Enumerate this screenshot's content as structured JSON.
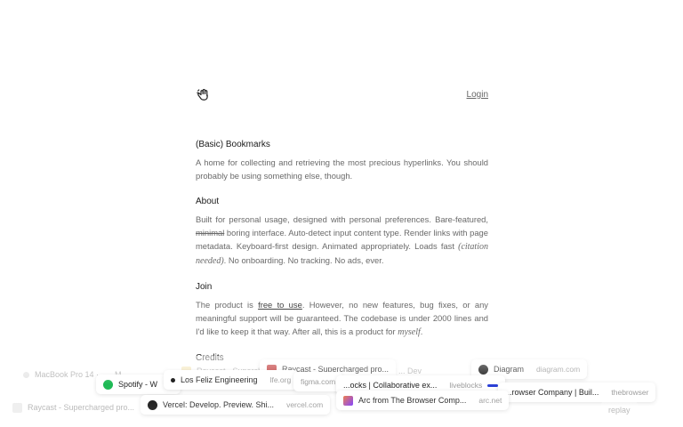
{
  "header": {
    "login_label": "Login"
  },
  "intro": {
    "title": "(Basic) Bookmarks",
    "text": "A home for collecting and retrieving the most precious hyperlinks. You should probably be using something else, though."
  },
  "about": {
    "title": "About",
    "text_a": "Built for personal usage, designed with personal preferences. Bare-featured, ",
    "strike": "minimal",
    "text_b": " boring interface. Auto-detect input content type. Render links with page metadata. Keyboard-first design. Animated appropriately. Loads fast ",
    "citation": "(citation needed)",
    "text_c": ". No onboarding. No tracking. No ads, ever."
  },
  "join": {
    "title": "Join",
    "text_a": "The product is ",
    "link": "free to use",
    "text_b": ". However, no new features, bug fixes, or any meaningful support will be guaranteed. The codebase is under 2000 lines and I'd like to keep it that way. After all, this is a product for ",
    "myself": "myself",
    "text_c": "."
  },
  "credits": {
    "title": "Credits"
  },
  "cards": [
    {
      "title": "MacBook Pro 14 · ... · M",
      "domain": "",
      "icon": "apple-icon",
      "color": "#999999",
      "faded": true
    },
    {
      "title": "Raycast - Supercharged pro...",
      "domain": "",
      "icon": "raycast-icon",
      "color": "#d14242",
      "faded": true
    },
    {
      "title": "Raycast - Supercharged pro...",
      "domain": "",
      "icon": "raycast-icon",
      "color": "#333333",
      "faded": false
    },
    {
      "title": "Spotify - W",
      "domain": "",
      "icon": "spotify-icon",
      "color": "#1db954",
      "faded": false
    },
    {
      "title": "Los Feliz Engineering",
      "domain": "lfe.org",
      "icon": "dot-icon",
      "color": "#111111",
      "faded": false
    },
    {
      "title": "figma.com",
      "domain": "",
      "icon": "figma-icon",
      "color": "#ffffff",
      "faded": false
    },
    {
      "title": "Vercel: Develop. Preview. Shi...",
      "domain": "vercel.com",
      "icon": "vercel-icon",
      "color": "#111111",
      "faded": false
    },
    {
      "title": "...ocks | Collaborative ex...",
      "domain": "liveblocks",
      "icon": "liveblocks-icon",
      "color": "#ffffff",
      "faded": false
    },
    {
      "title": "Arc from The Browser Comp...",
      "domain": "arc.net",
      "icon": "arc-icon",
      "color": "#7b3fe4",
      "faded": false
    },
    {
      "title": "Diagram",
      "domain": "diagram.com",
      "icon": "diagram-icon",
      "color": "#111111",
      "faded": false
    },
    {
      "title": "...rowser Company | Buil...",
      "domain": "thebrowser",
      "icon": "browser-icon",
      "color": "#3344cc",
      "faded": false
    },
    {
      "title": "... Dev",
      "domain": "",
      "icon": "dev-icon",
      "color": "#dddddd",
      "faded": true
    },
    {
      "title": "replay",
      "domain": "",
      "icon": "replay-icon",
      "color": "#dddddd",
      "faded": true
    }
  ]
}
